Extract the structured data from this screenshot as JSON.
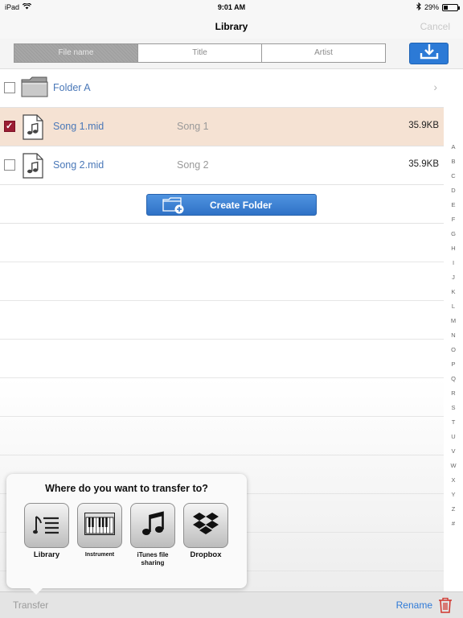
{
  "status_bar": {
    "device": "iPad",
    "time": "9:01 AM",
    "battery": "29%",
    "battery_level": 0.29
  },
  "navbar": {
    "title": "Library",
    "cancel_label": "Cancel"
  },
  "sort": {
    "segments": [
      "File name",
      "Title",
      "Artist"
    ],
    "active": "File name"
  },
  "files": [
    {
      "name": "Folder A",
      "type": "folder",
      "title": "",
      "size": "",
      "checked": false
    },
    {
      "name": "Song 1.mid",
      "type": "file",
      "title": "Song 1",
      "size": "35.9KB",
      "checked": true
    },
    {
      "name": "Song 2.mid",
      "type": "file",
      "title": "Song 2",
      "size": "35.9KB",
      "checked": false
    }
  ],
  "create_folder_label": "Create Folder",
  "index_letters": [
    "A",
    "B",
    "C",
    "D",
    "E",
    "F",
    "G",
    "H",
    "I",
    "J",
    "K",
    "L",
    "M",
    "N",
    "O",
    "P",
    "Q",
    "R",
    "S",
    "T",
    "U",
    "V",
    "W",
    "X",
    "Y",
    "Z",
    "#"
  ],
  "popover": {
    "heading": "Where do you want to transfer to?",
    "destinations": [
      {
        "label": "Library",
        "icon": "library-icon"
      },
      {
        "label": "Instrument",
        "icon": "piano-icon"
      },
      {
        "label": "iTunes file sharing",
        "icon": "music-note-icon"
      },
      {
        "label": "Dropbox",
        "icon": "dropbox-icon"
      }
    ]
  },
  "toolbar": {
    "transfer_label": "Transfer",
    "rename_label": "Rename"
  },
  "colors": {
    "accent": "#2f7ad7",
    "selected_row": "#f5e2d3",
    "checkbox": "#9b1d33",
    "delete": "#d0342c"
  }
}
